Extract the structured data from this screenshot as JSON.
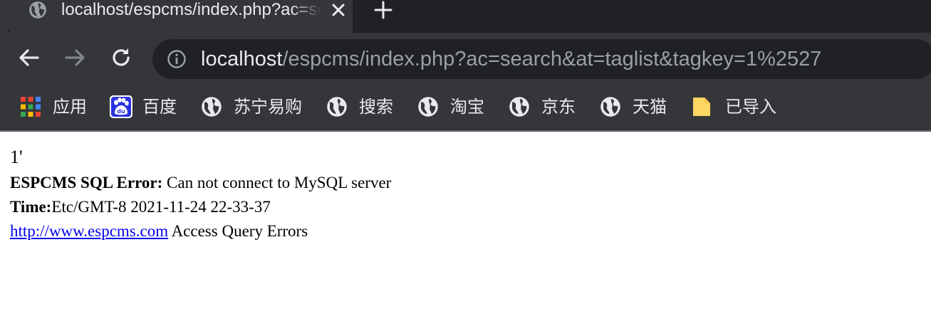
{
  "browser": {
    "tab": {
      "title": "localhost/espcms/index.php?ac=search&at=taglist&tagkey=1%2527",
      "favicon": "globe-icon",
      "close_icon": "close-icon"
    },
    "new_tab_icon": "plus-icon",
    "toolbar": {
      "back_icon": "arrow-left-icon",
      "forward_icon": "arrow-right-icon",
      "reload_icon": "reload-icon",
      "info_icon": "info-icon",
      "url_host": "localhost",
      "url_path": "/espcms/index.php?ac=search&at=taglist&tagkey=1%2527"
    },
    "bookmarks": [
      {
        "label": "应用",
        "icon": "apps-grid-icon"
      },
      {
        "label": "百度",
        "icon": "baidu-paw-icon"
      },
      {
        "label": "苏宁易购",
        "icon": "globe-icon"
      },
      {
        "label": "搜索",
        "icon": "globe-icon"
      },
      {
        "label": "淘宝",
        "icon": "globe-icon"
      },
      {
        "label": "京东",
        "icon": "globe-icon"
      },
      {
        "label": "天猫",
        "icon": "globe-icon"
      },
      {
        "label": "已导入",
        "icon": "folder-icon"
      }
    ]
  },
  "page": {
    "first_line": "1'",
    "error_label": "ESPCMS SQL Error:",
    "error_message": " Can not connect to MySQL server",
    "time_label": "Time:",
    "time_value": "Etc/GMT-8 2021-11-24 22-33-37",
    "link_text": "http://www.espcms.com",
    "link_suffix": " Access Query Errors"
  },
  "colors": {
    "tabstrip_bg": "#202124",
    "toolbar_bg": "#35363a",
    "omnibox_bg": "#202124",
    "text_light": "#e8eaed",
    "text_dim": "#9aa0a6",
    "link": "#0000ee"
  }
}
